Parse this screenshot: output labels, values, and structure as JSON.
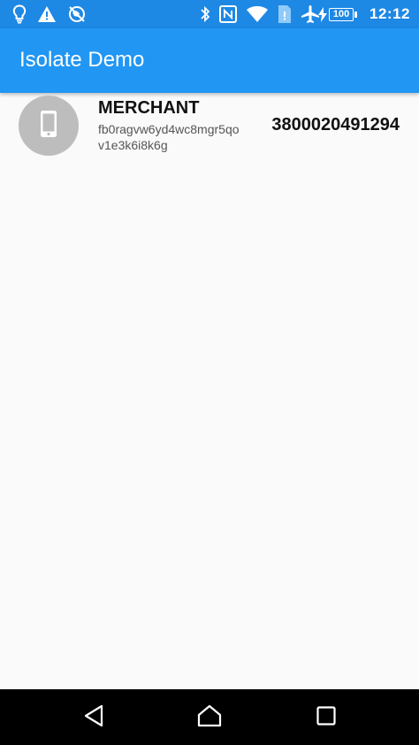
{
  "status_bar": {
    "time": "12:12",
    "battery": "100",
    "left_icons": [
      "lightbulb-icon",
      "warning-icon",
      "no-location-icon"
    ],
    "right_icons": [
      "bluetooth-icon",
      "nfc-icon",
      "wifi-icon",
      "sim-icon",
      "airplane-icon",
      "charging-icon"
    ],
    "background": "#1e88e5"
  },
  "app_bar": {
    "title": "Isolate Demo",
    "background": "#2196f3"
  },
  "list": {
    "items": [
      {
        "icon": "phone-icon",
        "title": "MERCHANT",
        "subtitle": "fb0ragvw6yd4wc8mgr5qov1e3k6i8k6g",
        "value": "3800020491294"
      }
    ]
  },
  "nav_bar": {
    "buttons": [
      "back-icon",
      "home-icon",
      "recents-icon"
    ]
  }
}
